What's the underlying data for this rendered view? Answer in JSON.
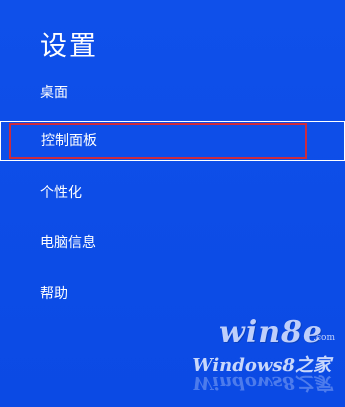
{
  "settings_panel": {
    "title": "设置",
    "items": [
      {
        "label": "桌面"
      },
      {
        "label": "控制面板",
        "selected": true
      },
      {
        "label": "个性化"
      },
      {
        "label": "电脑信息"
      },
      {
        "label": "帮助"
      }
    ]
  },
  "watermark": {
    "main": "win8e",
    "suffix": ".com",
    "sub": "Windows8之家"
  },
  "colors": {
    "background": "#0d4ee6",
    "highlight_outline": "#cc2b3e",
    "text": "#ffffff"
  }
}
